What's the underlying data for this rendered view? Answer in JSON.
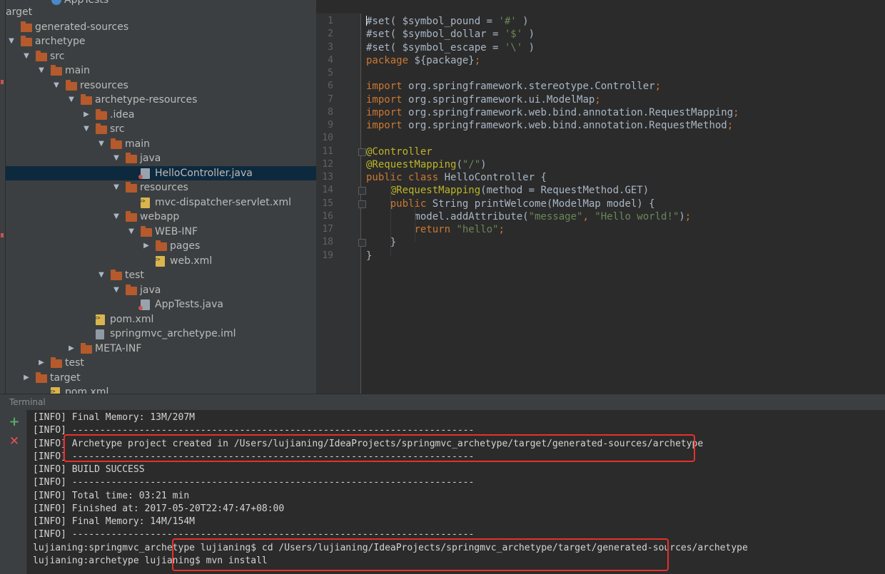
{
  "project_tree": {
    "items": [
      {
        "label": "arget",
        "depth": 0,
        "type": "text",
        "expanded": null
      },
      {
        "label": "generated-sources",
        "depth": 0,
        "type": "folder",
        "expanded": null
      },
      {
        "label": "archetype",
        "depth": 0,
        "type": "folder",
        "expanded": true
      },
      {
        "label": "src",
        "depth": 1,
        "type": "folder",
        "expanded": true
      },
      {
        "label": "main",
        "depth": 2,
        "type": "folder",
        "expanded": true
      },
      {
        "label": "resources",
        "depth": 3,
        "type": "folder",
        "expanded": true
      },
      {
        "label": "archetype-resources",
        "depth": 4,
        "type": "folder",
        "expanded": true
      },
      {
        "label": ".idea",
        "depth": 5,
        "type": "folder",
        "expanded": false
      },
      {
        "label": "src",
        "depth": 5,
        "type": "folder",
        "expanded": true
      },
      {
        "label": "main",
        "depth": 6,
        "type": "folder",
        "expanded": true
      },
      {
        "label": "java",
        "depth": 7,
        "type": "folder",
        "expanded": true
      },
      {
        "label": "HelloController.java",
        "depth": 8,
        "type": "java",
        "expanded": null,
        "selected": true
      },
      {
        "label": "resources",
        "depth": 7,
        "type": "folder",
        "expanded": true
      },
      {
        "label": "mvc-dispatcher-servlet.xml",
        "depth": 8,
        "type": "xml",
        "expanded": null
      },
      {
        "label": "webapp",
        "depth": 7,
        "type": "folder",
        "expanded": true
      },
      {
        "label": "WEB-INF",
        "depth": 8,
        "type": "folder",
        "expanded": true
      },
      {
        "label": "pages",
        "depth": 9,
        "type": "folder",
        "expanded": false
      },
      {
        "label": "web.xml",
        "depth": 9,
        "type": "xml",
        "expanded": null
      },
      {
        "label": "test",
        "depth": 6,
        "type": "folder",
        "expanded": true
      },
      {
        "label": "java",
        "depth": 7,
        "type": "folder",
        "expanded": true
      },
      {
        "label": "AppTests.java",
        "depth": 8,
        "type": "java",
        "expanded": null
      },
      {
        "label": "pom.xml",
        "depth": 5,
        "type": "xml",
        "expanded": null
      },
      {
        "label": "springmvc_archetype.iml",
        "depth": 5,
        "type": "iml",
        "expanded": null
      },
      {
        "label": "META-INF",
        "depth": 4,
        "type": "folder",
        "expanded": false
      },
      {
        "label": "test",
        "depth": 2,
        "type": "folder",
        "expanded": false
      },
      {
        "label": "target",
        "depth": 1,
        "type": "folder",
        "expanded": false
      },
      {
        "label": "pom.xml",
        "depth": 2,
        "type": "xml",
        "expanded": null
      }
    ],
    "top_partial_label": "AppTests"
  },
  "editor": {
    "lines": [
      {
        "n": "1",
        "tokens": [
          {
            "t": "#set( $symbol_pound = ",
            "c": "plain"
          },
          {
            "t": "'#'",
            "c": "str"
          },
          {
            "t": " )",
            "c": "plain"
          }
        ]
      },
      {
        "n": "2",
        "tokens": [
          {
            "t": "#set( $symbol_dollar = ",
            "c": "plain"
          },
          {
            "t": "'$'",
            "c": "str"
          },
          {
            "t": " )",
            "c": "plain"
          }
        ]
      },
      {
        "n": "3",
        "tokens": [
          {
            "t": "#set( $symbol_escape = ",
            "c": "plain"
          },
          {
            "t": "'\\'",
            "c": "str"
          },
          {
            "t": " )",
            "c": "plain"
          }
        ]
      },
      {
        "n": "4",
        "tokens": [
          {
            "t": "package",
            "c": "kw"
          },
          {
            "t": " ${package}",
            "c": "plain"
          },
          {
            "t": ";",
            "c": "kw"
          }
        ]
      },
      {
        "n": "5",
        "tokens": []
      },
      {
        "n": "6",
        "tokens": [
          {
            "t": "import",
            "c": "kw"
          },
          {
            "t": " org.springframework.stereotype.Controller",
            "c": "plain"
          },
          {
            "t": ";",
            "c": "kw"
          }
        ]
      },
      {
        "n": "7",
        "tokens": [
          {
            "t": "import",
            "c": "kw"
          },
          {
            "t": " org.springframework.ui.ModelMap",
            "c": "plain"
          },
          {
            "t": ";",
            "c": "kw"
          }
        ]
      },
      {
        "n": "8",
        "tokens": [
          {
            "t": "import",
            "c": "kw"
          },
          {
            "t": " org.springframework.web.bind.annotation.RequestMapping",
            "c": "plain"
          },
          {
            "t": ";",
            "c": "kw"
          }
        ]
      },
      {
        "n": "9",
        "tokens": [
          {
            "t": "import",
            "c": "kw"
          },
          {
            "t": " org.springframework.web.bind.annotation.RequestMethod",
            "c": "plain"
          },
          {
            "t": ";",
            "c": "kw"
          }
        ]
      },
      {
        "n": "10",
        "tokens": []
      },
      {
        "n": "11",
        "tokens": [
          {
            "t": "@Controller",
            "c": "ann"
          }
        ]
      },
      {
        "n": "12",
        "tokens": [
          {
            "t": "@RequestMapping",
            "c": "ann"
          },
          {
            "t": "(",
            "c": "plain"
          },
          {
            "t": "\"/\"",
            "c": "str"
          },
          {
            "t": ")",
            "c": "plain"
          }
        ]
      },
      {
        "n": "13",
        "tokens": [
          {
            "t": "public class",
            "c": "kw"
          },
          {
            "t": " HelloController {",
            "c": "plain"
          }
        ]
      },
      {
        "n": "14",
        "tokens": [
          {
            "t": "    ",
            "c": "plain"
          },
          {
            "t": "@RequestMapping",
            "c": "ann"
          },
          {
            "t": "(method = RequestMethod.GET)",
            "c": "plain"
          }
        ]
      },
      {
        "n": "15",
        "tokens": [
          {
            "t": "    ",
            "c": "plain"
          },
          {
            "t": "public",
            "c": "kw"
          },
          {
            "t": " String printWelcome(ModelMap model) {",
            "c": "plain"
          }
        ]
      },
      {
        "n": "16",
        "tokens": [
          {
            "t": "        model.addAttribute(",
            "c": "plain"
          },
          {
            "t": "\"message\"",
            "c": "str"
          },
          {
            "t": ", ",
            "c": "kw"
          },
          {
            "t": "\"Hello world!\"",
            "c": "str"
          },
          {
            "t": ")",
            "c": "plain"
          },
          {
            "t": ";",
            "c": "kw"
          }
        ]
      },
      {
        "n": "17",
        "tokens": [
          {
            "t": "        ",
            "c": "plain"
          },
          {
            "t": "return",
            "c": "kw"
          },
          {
            "t": " ",
            "c": "plain"
          },
          {
            "t": "\"hello\"",
            "c": "str"
          },
          {
            "t": ";",
            "c": "kw"
          }
        ]
      },
      {
        "n": "18",
        "tokens": [
          {
            "t": "    }",
            "c": "plain"
          }
        ]
      },
      {
        "n": "19",
        "tokens": [
          {
            "t": "}",
            "c": "plain"
          }
        ]
      }
    ],
    "fold_markers": [
      "11",
      "14",
      "15",
      "18"
    ]
  },
  "terminal": {
    "title": "Terminal",
    "new_session_icon": "plus-icon",
    "close_session_icon": "close-icon",
    "lines": [
      "[INFO] Final Memory: 13M/207M",
      "[INFO] ------------------------------------------------------------------------",
      "[INFO] Archetype project created in /Users/lujianing/IdeaProjects/springmvc_archetype/target/generated-sources/archetype",
      "[INFO] ------------------------------------------------------------------------",
      "[INFO] BUILD SUCCESS",
      "[INFO] ------------------------------------------------------------------------",
      "[INFO] Total time: 03:21 min",
      "[INFO] Finished at: 2017-05-20T22:47:47+08:00",
      "[INFO] Final Memory: 14M/154M",
      "[INFO] ------------------------------------------------------------------------",
      "lujianing:springmvc_archetype lujianing$ cd /Users/lujianing/IdeaProjects/springmvc_archetype/target/generated-sources/archetype",
      "lujianing:archetype lujianing$ mvn install"
    ]
  },
  "colors": {
    "highlight_box": "#e8302a",
    "keyword": "#cc7832",
    "string": "#6a8759",
    "annotation": "#bbb529",
    "selection": "#0d293e"
  }
}
